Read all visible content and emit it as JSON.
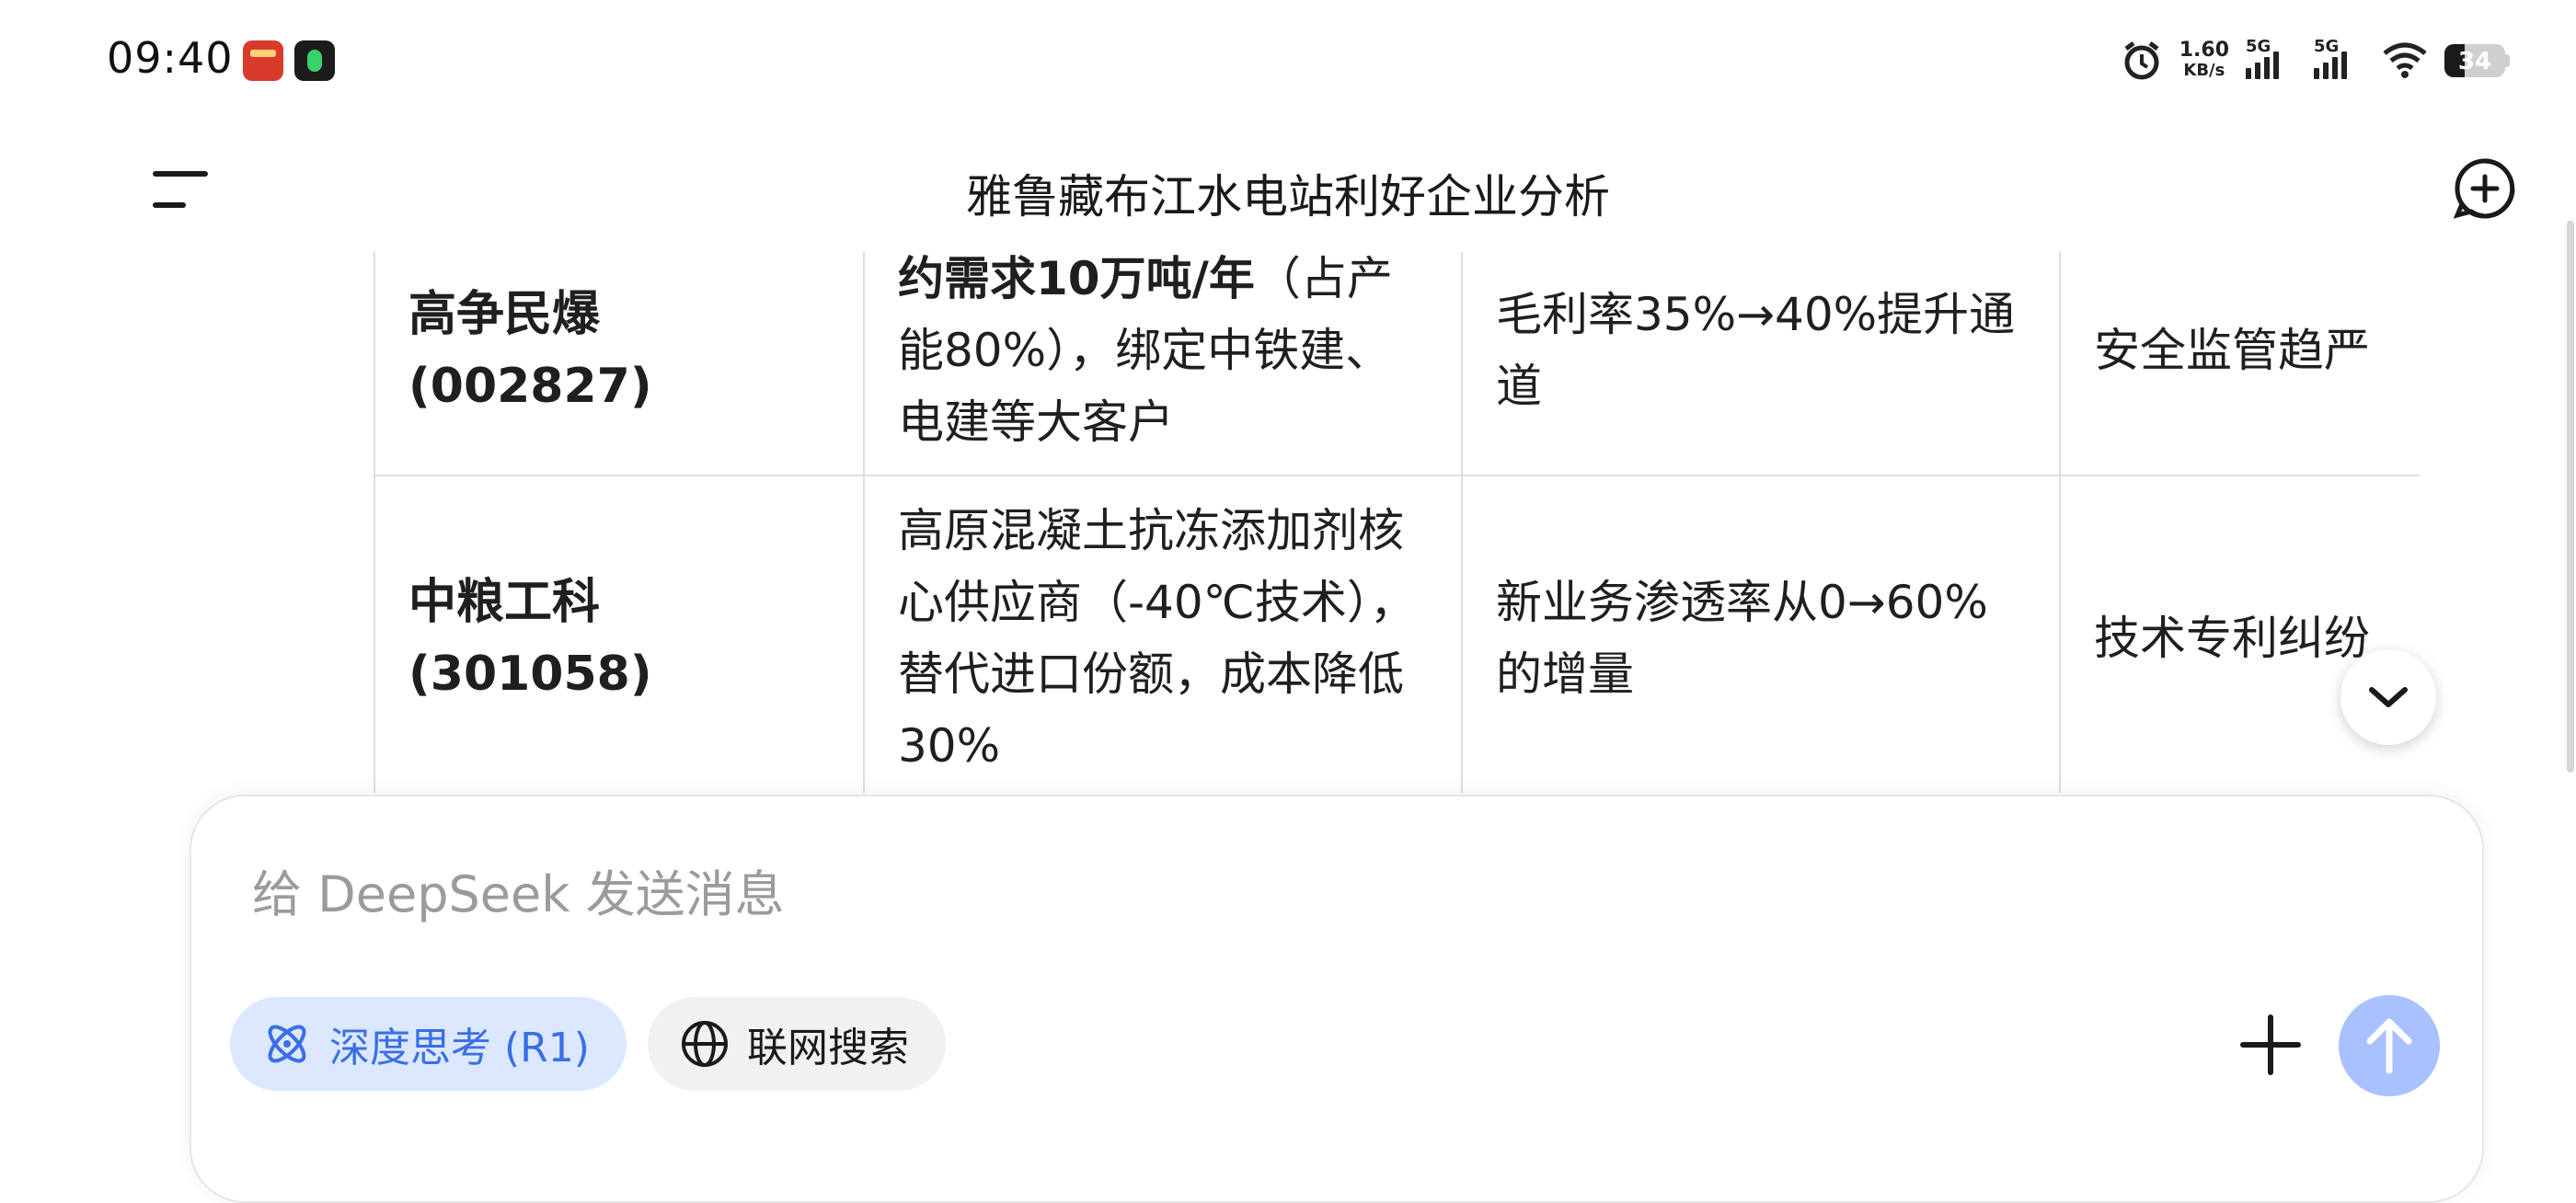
{
  "status_bar": {
    "time": "09:40",
    "net_speed_value": "1.60",
    "net_speed_unit": "KB/s",
    "signal1_label": "5G",
    "signal2_label": "5G",
    "battery": "34"
  },
  "header": {
    "title": "雅鲁藏布江水电站利好企业分析"
  },
  "table": {
    "rows": [
      {
        "name": "高争民爆(002827)",
        "desc_bold": "约需求10万吨/年",
        "desc_rest": "（占产能80%），绑定中铁建、电建等大客户",
        "growth": "毛利率35%→40%提升通道",
        "risk": "安全监管趋严"
      },
      {
        "name": "中粮工科(301058)",
        "desc_bold": "",
        "desc_rest": "高原混凝土抗冻添加剂核心供应商（-40℃技术），替代进口份额，成本降低30%",
        "growth": "新业务渗透率从0→60%的增量",
        "risk": "技术专利纠纷"
      }
    ]
  },
  "composer": {
    "placeholder": "给 DeepSeek 发送消息",
    "deep_think_label": "深度思考 (R1)",
    "web_search_label": "联网搜索"
  },
  "colors": {
    "accent": "#3a6ee8",
    "accent_light": "#dbe8ff",
    "send_disabled": "#a9c1ff"
  }
}
